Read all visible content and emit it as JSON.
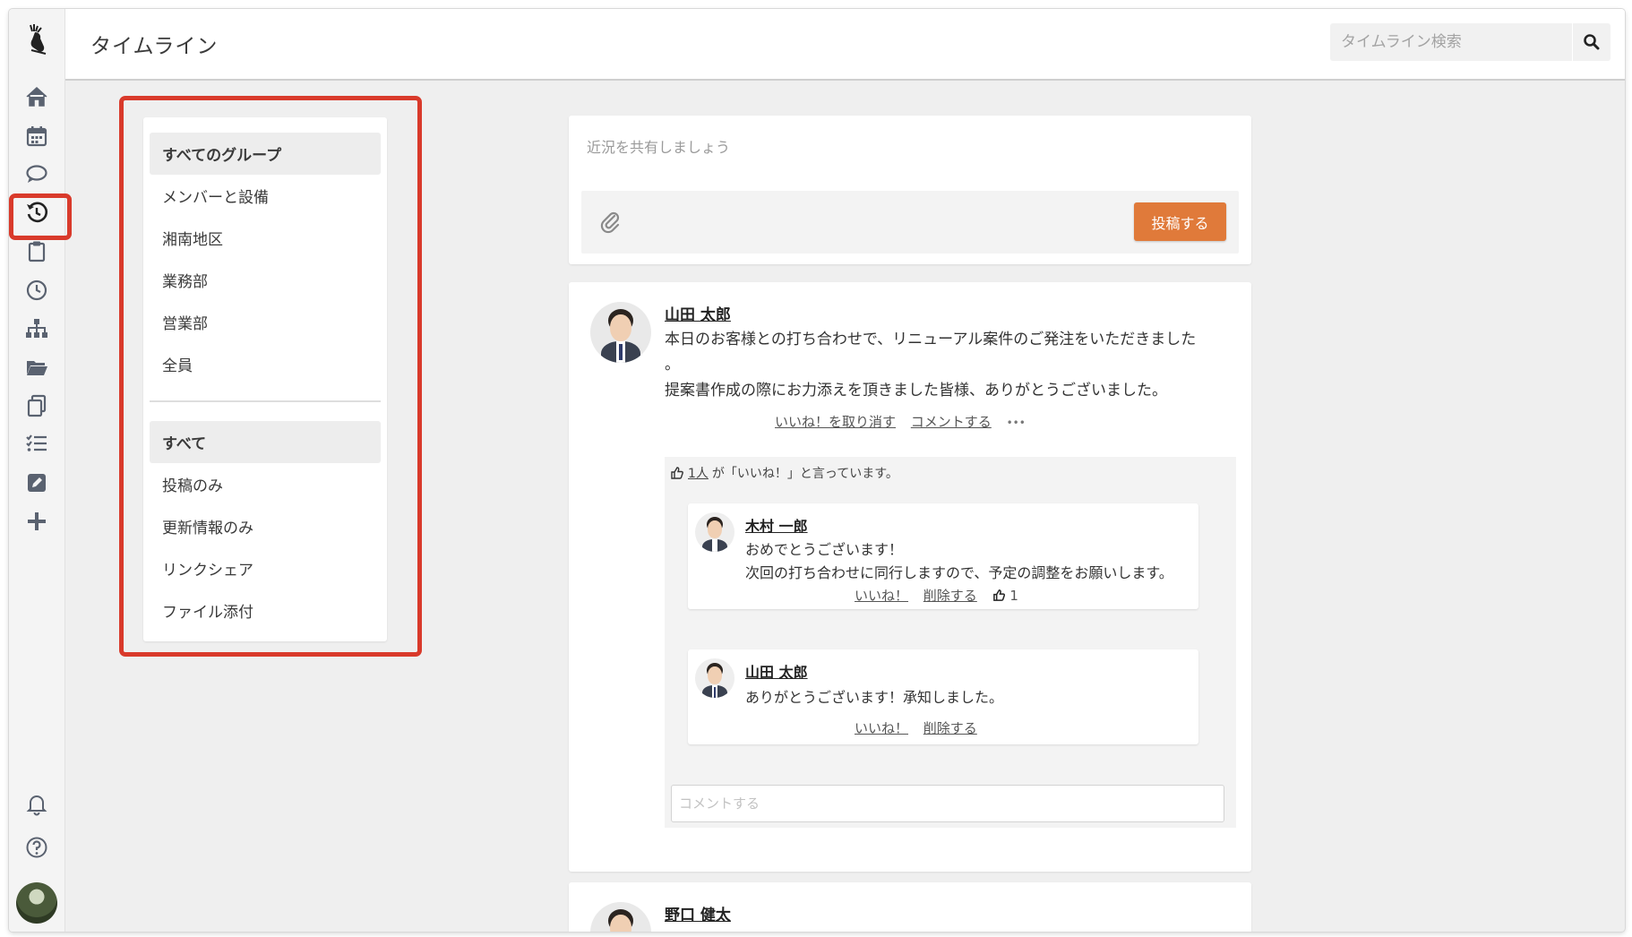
{
  "header": {
    "title": "タイムライン",
    "search_placeholder": "タイムライン検索"
  },
  "rail": {
    "items": [
      "home-icon",
      "calendar-icon",
      "chat-icon",
      "history-icon",
      "clipboard-icon",
      "clock-icon",
      "org-chart-icon",
      "folder-icon",
      "copy-icon",
      "checklist-icon",
      "edit-icon",
      "plus-icon"
    ],
    "active": "history-icon",
    "bottom": [
      "bell-icon",
      "help-icon"
    ]
  },
  "filters": {
    "groups": [
      {
        "label": "すべてのグループ",
        "active": true
      },
      {
        "label": "メンバーと設備",
        "active": false
      },
      {
        "label": "湘南地区",
        "active": false
      },
      {
        "label": "業務部",
        "active": false
      },
      {
        "label": "営業部",
        "active": false
      },
      {
        "label": "全員",
        "active": false
      }
    ],
    "types": [
      {
        "label": "すべて",
        "active": true
      },
      {
        "label": "投稿のみ",
        "active": false
      },
      {
        "label": "更新情報のみ",
        "active": false
      },
      {
        "label": "リンクシェア",
        "active": false
      },
      {
        "label": "ファイル添付",
        "active": false
      }
    ]
  },
  "composer": {
    "placeholder": "近況を共有しましょう",
    "post_label": "投稿する"
  },
  "post": {
    "author": "山田 太郎",
    "line1": "本日のお客様との打ち合わせで、リニューアル案件のご発注をいただきました",
    "line2": "。",
    "line3": "提案書作成の際にお力添えを頂きました皆様、ありがとうございました。",
    "unlike_label": "いいね！を取り消す",
    "comment_label": "コメントする",
    "more_label": "•••",
    "like_count_link": "1人",
    "like_summary_rest": "が「いいね！」と言っています。",
    "comments": [
      {
        "author": "木村 一郎",
        "line1": "おめでとうございます！",
        "line2": "次回の打ち合わせに同行しますので、予定の調整をお願いします。",
        "like_label": "いいね！",
        "delete_label": "削除する",
        "like_count": "1"
      },
      {
        "author": "山田 太郎",
        "line1": "ありがとうございます！承知しました。",
        "like_label": "いいね！",
        "delete_label": "削除する"
      }
    ],
    "comment_placeholder": "コメントする"
  },
  "next_post": {
    "author": "野口 健太"
  },
  "colors": {
    "accent": "#e07a3a",
    "highlight": "#d93a2b",
    "rail_icon": "#5a6270"
  }
}
